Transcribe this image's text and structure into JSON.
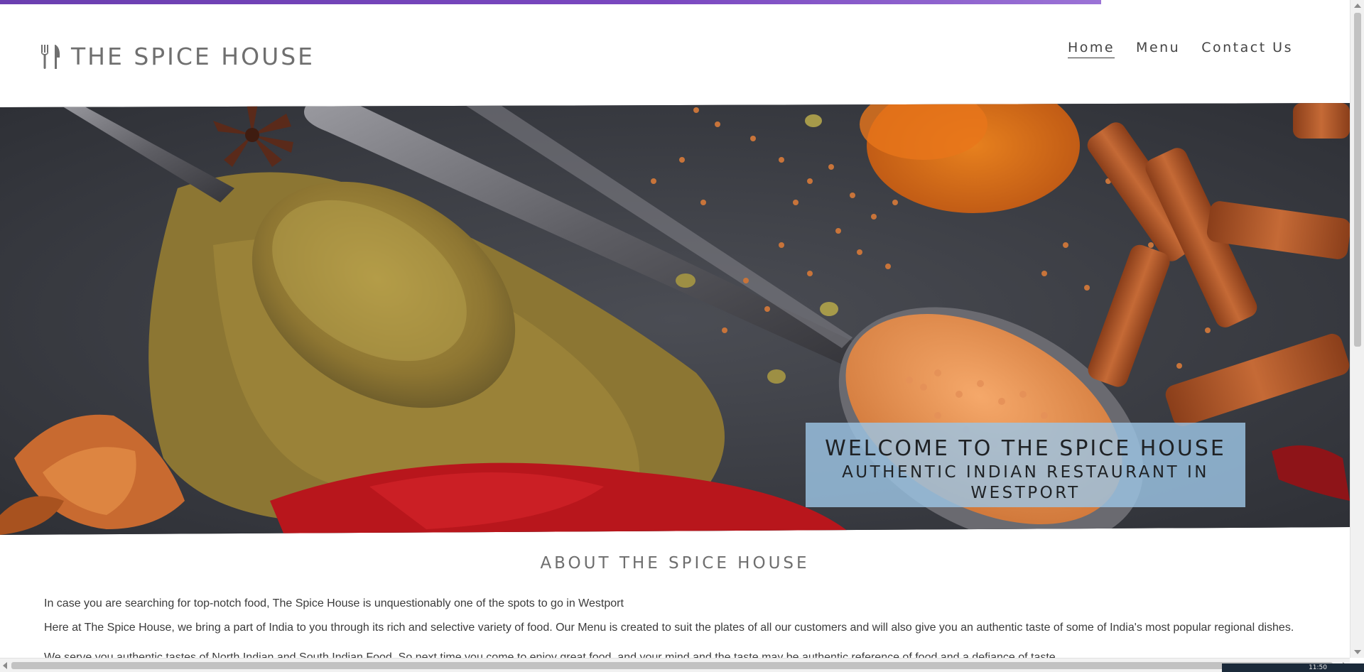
{
  "header": {
    "logo_text": "THE SPICE HOUSE",
    "logo_icon": "fork-knife-icon",
    "nav": [
      {
        "label": "Home",
        "active": true
      },
      {
        "label": "Menu",
        "active": false
      },
      {
        "label": "Contact Us",
        "active": false
      }
    ]
  },
  "hero": {
    "title": "WELCOME TO THE SPICE HOUSE",
    "subtitle": "AUTHENTIC INDIAN RESTAURANT IN WESTPORT"
  },
  "about": {
    "heading": "ABOUT THE SPICE HOUSE",
    "paragraphs": [
      "In case you are searching for top-notch food, The Spice House is unquestionably one of the spots to go in Westport",
      "Here at The Spice House, we bring a part of India to you through its rich and selective variety of food. Our Menu is created to suit the plates of all our customers and will also give you an authentic taste of some of India's most popular regional dishes.",
      "We serve you authentic tastes of North Indian and South Indian Food. So next time you come to enjoy great food, and your mind and the taste may be authentic reference of food and a defiance of taste..."
    ]
  },
  "system": {
    "clock": "11:50"
  },
  "colors": {
    "accent_strip": "#6b3fb0",
    "welcome_box": "#9cc4e4"
  }
}
